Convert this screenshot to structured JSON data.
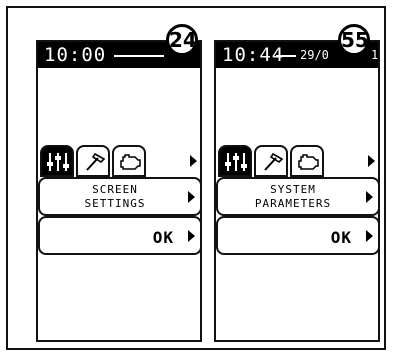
{
  "left_screen": {
    "time": "10:00",
    "callout": "24",
    "menu_panel": "SCREEN\nSETTINGS",
    "ok_label": "OK"
  },
  "right_screen": {
    "time": "10:44",
    "date": "29/0",
    "callout": "55",
    "date_tail": "1",
    "menu_panel": "SYSTEM\nPARAMETERS",
    "ok_label": "OK"
  },
  "icons": {
    "tab_1": "sliders-icon",
    "tab_2": "hammer-icon",
    "tab_3": "engine-icon",
    "next": "arrow-right-icon"
  }
}
